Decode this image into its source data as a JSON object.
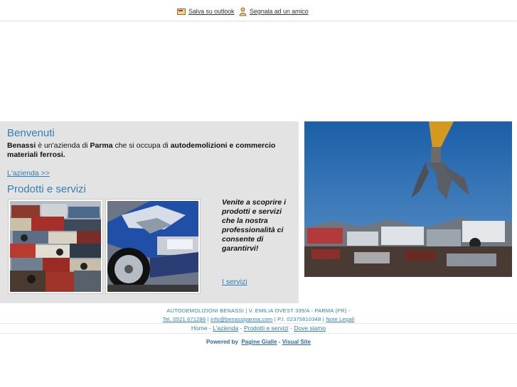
{
  "topbar": {
    "save_label": "Salva su outlook",
    "save_icon": "outlook-icon",
    "share_label": "Segnala ad un amico",
    "share_icon": "person-icon"
  },
  "welcome": {
    "title": "Benvenuti",
    "company": "Benassi",
    "text1": " è un'azienda di ",
    "city": "Parma",
    "text2": " che si occupa di ",
    "activity": "autodemolizioni e commercio materiali ferrosi.",
    "link": "L'azienda >>"
  },
  "products": {
    "title": "Prodotti e servizi",
    "promo": "Venite a scoprire i prodotti e servizi che la nostra professionalità ci consente di garantirvi!",
    "link": "I servizi"
  },
  "footer": {
    "address": "AUTODEMOLIZIONI BENASSI | V. EMILIA OVEST 339/A - PARMA (PR) -",
    "phone": "Tel. 0521 671286",
    "email": "info@benassiparma.com",
    "vat": "P.I. 02375610348",
    "legal": "Note Legali",
    "sep": " | ",
    "nav": [
      {
        "label": "Home"
      },
      {
        "label": "L'azienda"
      },
      {
        "label": "Prodotti e servizi"
      },
      {
        "label": "Dove siamo"
      }
    ],
    "nav_sep": " - ",
    "powered_label": "Powered by",
    "powered_link1": "Pagine Gialle",
    "powered_dash": " - ",
    "powered_link2": "Visual Site"
  },
  "colors": {
    "accent": "#2f7fb4",
    "panel_bg": "#e3e3e3"
  }
}
